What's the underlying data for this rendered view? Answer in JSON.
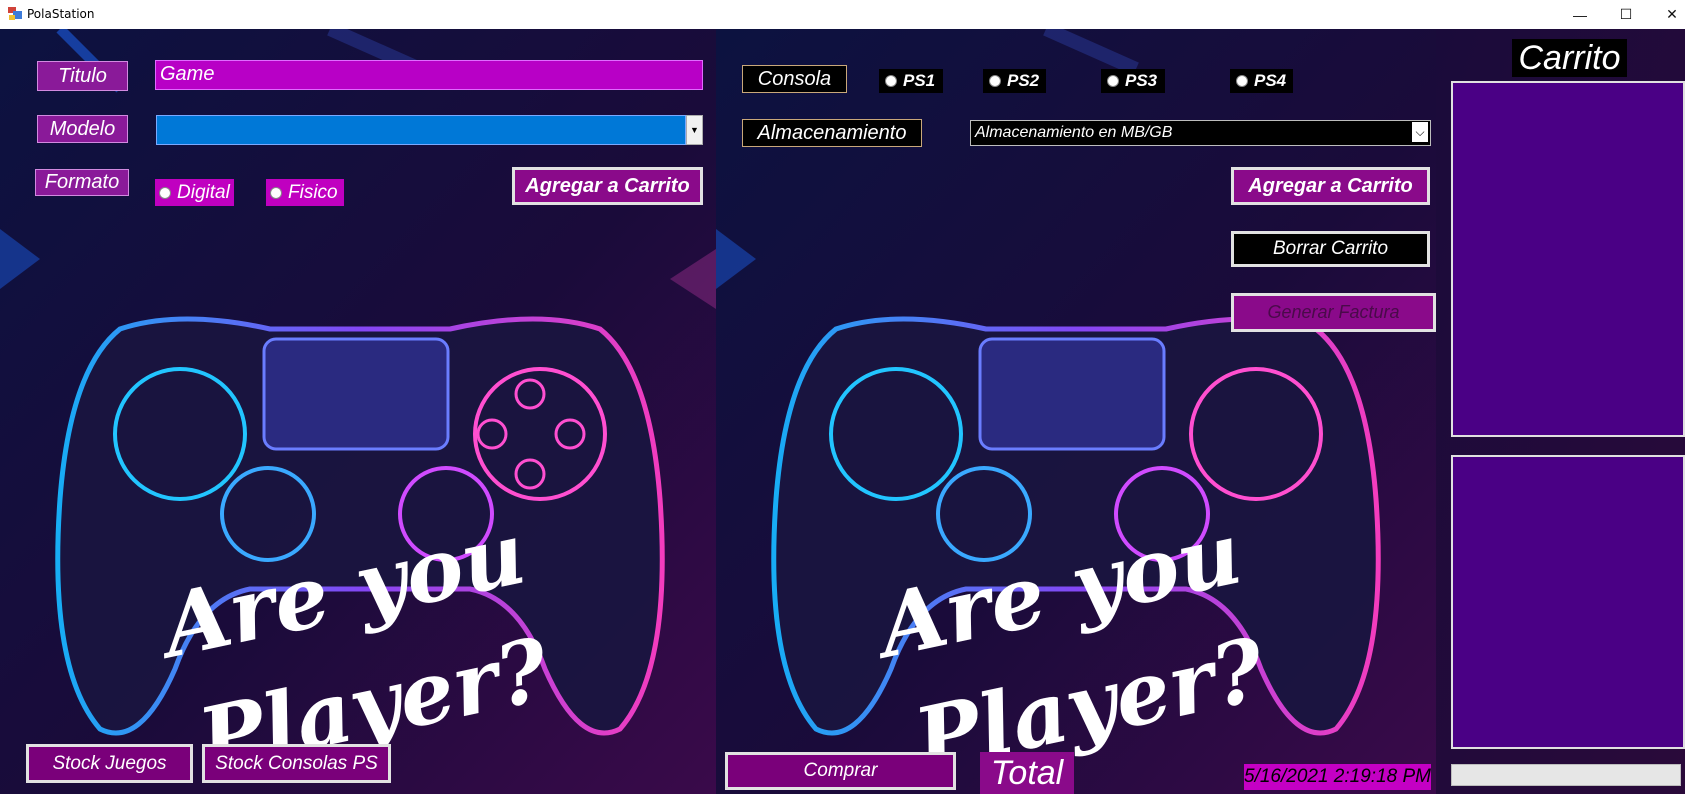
{
  "window": {
    "title": "PolaStation",
    "controls": {
      "minimize": "—",
      "maximize": "☐",
      "close": "✕"
    }
  },
  "art": {
    "text_line1": "Are you",
    "text_line2": "Player?"
  },
  "game_form": {
    "titulo_label": "Titulo",
    "titulo_value": "Game",
    "modelo_label": "Modelo",
    "modelo_value": "",
    "formato_label": "Formato",
    "formato_options": [
      "Digital",
      "Fisico"
    ],
    "add_button": "Agregar a Carrito",
    "stock_juegos_button": "Stock Juegos",
    "stock_consolas_button": "Stock Consolas PS"
  },
  "console_form": {
    "consola_label": "Consola",
    "consola_options": [
      "PS1",
      "PS2",
      "PS3",
      "PS4"
    ],
    "almacenamiento_label": "Almacenamiento",
    "almacenamiento_placeholder": "Almacenamiento en MB/GB",
    "add_button": "Agregar a Carrito",
    "clear_button": "Borrar Carrito",
    "invoice_button": "Generar Factura",
    "buy_button": "Comprar",
    "total_label": "Total",
    "datetime": "5/16/2021 2:19:18 PM"
  },
  "cart": {
    "title": "Carrito"
  },
  "colors": {
    "purple": "#8a0a8a",
    "magenta": "#c000c0",
    "list_bg": "#4a0085",
    "combo_blue": "#0078d7"
  }
}
